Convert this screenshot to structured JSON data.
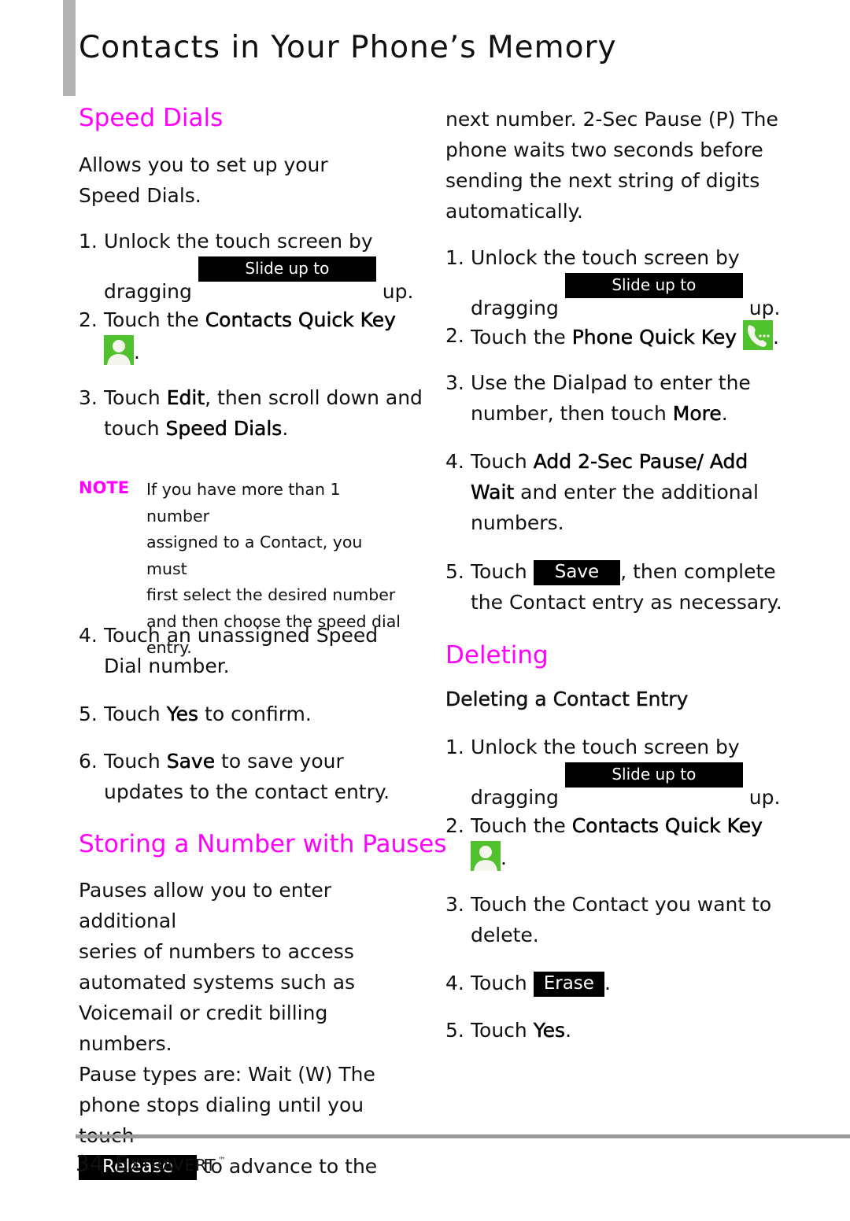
{
  "page": {
    "title": "Contacts in Your Phone’s Memory",
    "footer": {
      "page_number": "34",
      "brand_first": "E",
      "brand_rest": "XTRAVERT",
      "trademark": "™"
    }
  },
  "colors": {
    "accent": "#ff00ff",
    "icon_green": "#4fc22d",
    "button_bg": "#000000",
    "rule_gray": "#999999"
  },
  "left": {
    "speed_dials": {
      "heading": "Speed Dials",
      "intro": "Allows you to set up your Speed Dials.",
      "steps": [
        {
          "num": "1.",
          "pre": "Unlock the touch screen by dragging",
          "button": "Slide up to unlock",
          "post": "up."
        },
        {
          "num": "2.",
          "pre": "Touch the",
          "bold": "Contacts Quick Key",
          "icon": "contacts-quick-key-icon",
          "post": "."
        },
        {
          "num": "3.",
          "pre": "Touch",
          "bold": "Edit",
          "mid": ", then scroll down and touch",
          "bold2": "Speed Dials",
          "post": "."
        },
        {
          "num": "4.",
          "text": "Touch an unassigned Speed Dial number."
        },
        {
          "num": "5.",
          "pre": "Touch",
          "bold": "Yes",
          "post": "to confirm."
        },
        {
          "num": "6.",
          "pre": "Touch",
          "bold": "Save",
          "post": "to save your updates to the contact entry."
        }
      ],
      "note": {
        "label": "NOTE",
        "lines": [
          "If you have more than 1 number",
          "assigned to a Contact, you must",
          "first select the desired number",
          "and then choose the speed dial",
          "entry."
        ]
      }
    },
    "pauses": {
      "heading": "Storing a Number with Pauses",
      "lines": [
        "Pauses allow you to enter additional",
        "series of numbers to access",
        "automated systems such as",
        "Voicemail or credit billing numbers.",
        "Pause types are: Wait (W) The",
        "phone stops dialing until you touch"
      ],
      "release_button": "Release",
      "release_post": "to advance to the"
    }
  },
  "right": {
    "continuation": [
      "next number. 2-Sec Pause (P) The",
      "phone waits two seconds before",
      "sending the next string of digits",
      "automatically."
    ],
    "steps": [
      {
        "num": "1.",
        "pre": "Unlock the touch screen by dragging",
        "button": "Slide up to unlock",
        "post": "up."
      },
      {
        "num": "2.",
        "pre": "Touch the",
        "bold": "Phone Quick Key",
        "icon": "phone-quick-key-icon",
        "post": "."
      },
      {
        "num": "3.",
        "pre": "Use the Dialpad to enter the number, then touch",
        "bold": "More",
        "post": "."
      },
      {
        "num": "4.",
        "pre": "Touch",
        "bold": "Add 2-Sec Pause/ Add Wait",
        "post": "and enter the additional numbers."
      },
      {
        "num": "5.",
        "pre": "Touch",
        "button": "Save",
        "post": ", then complete the Contact entry as necessary."
      }
    ],
    "deleting": {
      "heading": "Deleting",
      "subheading": "Deleting a Contact Entry",
      "steps": [
        {
          "num": "1.",
          "pre": "Unlock the touch screen by dragging",
          "button": "Slide up to unlock",
          "post": "up."
        },
        {
          "num": "2.",
          "pre": "Touch the",
          "bold": "Contacts Quick Key",
          "icon": "contacts-quick-key-icon",
          "post": "."
        },
        {
          "num": "3.",
          "text": "Touch the Contact you want to delete."
        },
        {
          "num": "4.",
          "pre": "Touch",
          "button": "Erase",
          "post": "."
        },
        {
          "num": "5.",
          "pre": "Touch",
          "bold": "Yes",
          "post": "."
        }
      ]
    }
  }
}
